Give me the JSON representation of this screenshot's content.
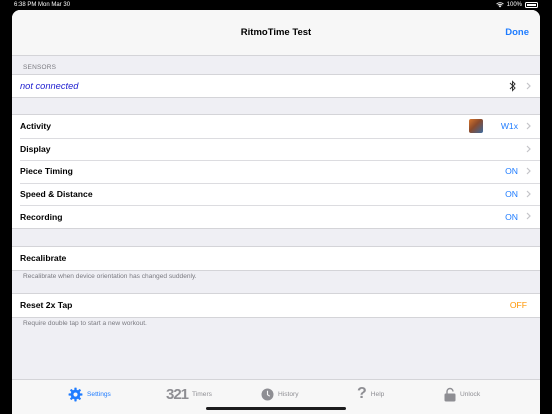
{
  "status_bar": {
    "time_date": "6:38 PM  Mon Mar 30",
    "battery": "100%"
  },
  "navbar": {
    "title": "RitmoTime Test",
    "done_label": "Done"
  },
  "sensors": {
    "header": "SENSORS",
    "status": "not connected",
    "icon": "bluetooth-icon"
  },
  "settings_rows": [
    {
      "label": "Activity",
      "value": "W1x"
    },
    {
      "label": "Display",
      "value": ""
    },
    {
      "label": "Piece Timing",
      "value": "ON"
    },
    {
      "label": "Speed & Distance",
      "value": "ON"
    },
    {
      "label": "Recording",
      "value": "ON"
    }
  ],
  "recalibrate": {
    "label": "Recalibrate",
    "footer": "Recalibrate when device orientation has changed suddenly."
  },
  "reset": {
    "label": "Reset 2x Tap",
    "value": "OFF",
    "footer": "Require double tap to start a new workout."
  },
  "tabs": [
    {
      "label": "Settings",
      "icon": "gear-icon",
      "active": true
    },
    {
      "label": "Timers",
      "icon": "timers-321-icon",
      "glyph": "321",
      "active": false
    },
    {
      "label": "History",
      "icon": "clock-icon",
      "active": false
    },
    {
      "label": "Help",
      "icon": "question-icon",
      "active": false
    },
    {
      "label": "Unlock",
      "icon": "lock-icon",
      "active": false
    }
  ],
  "colors": {
    "accent": "#1f7cff",
    "off": "#ff9500",
    "sensor_text": "#2020d0",
    "background": "#efeff4"
  }
}
